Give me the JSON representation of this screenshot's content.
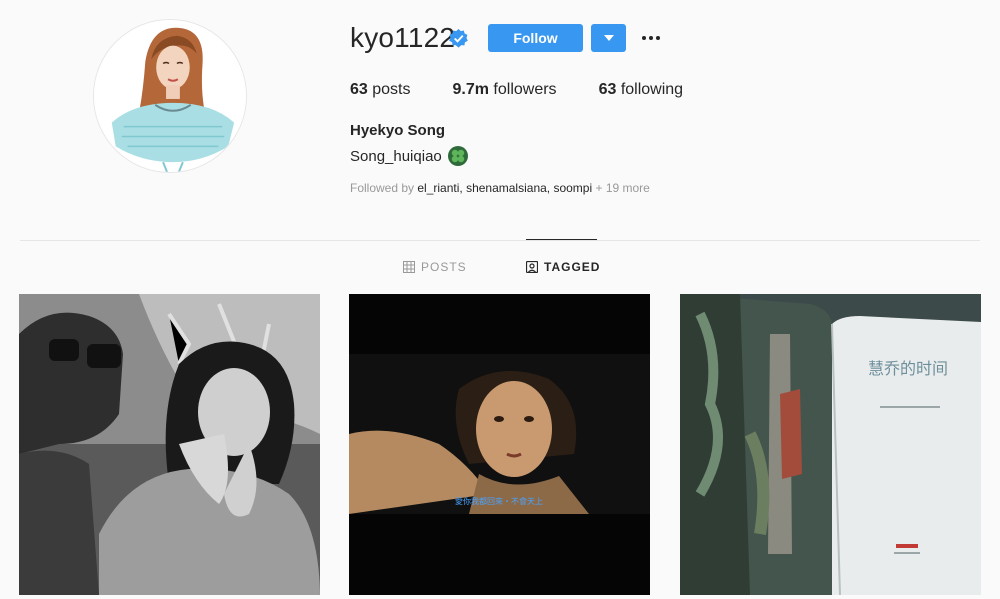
{
  "profile": {
    "username": "kyo1122",
    "verified_icon": "verified-badge-icon",
    "follow_label": "Follow",
    "full_name": "Hyekyo Song",
    "bio": "Song_huiqiao",
    "bio_emoji": "four-leaf-clover-icon",
    "stats": {
      "posts_count": "63",
      "posts_label": "posts",
      "followers_count": "9.7m",
      "followers_label": "followers",
      "following_count": "63",
      "following_label": "following"
    },
    "followed_by": {
      "prefix": "Followed by ",
      "names": "el_rianti, shenamalsiana, soompi",
      "more": " + 19 more"
    }
  },
  "tabs": [
    {
      "label": "POSTS",
      "icon": "grid-icon",
      "active": false
    },
    {
      "label": "TAGGED",
      "icon": "tagged-icon",
      "active": true
    }
  ],
  "posts": [
    {
      "icon": "photo-bw-two-people"
    },
    {
      "icon": "photo-film-still-with-subtitle",
      "subtitle": "愛你我都回來・不會天上"
    },
    {
      "icon": "photo-book-cover",
      "book_title": "慧乔的时间"
    }
  ],
  "colors": {
    "accent": "#3897f0",
    "text": "#262626",
    "muted": "#999999",
    "background": "#fafafa",
    "divider": "#e6e6e6"
  }
}
